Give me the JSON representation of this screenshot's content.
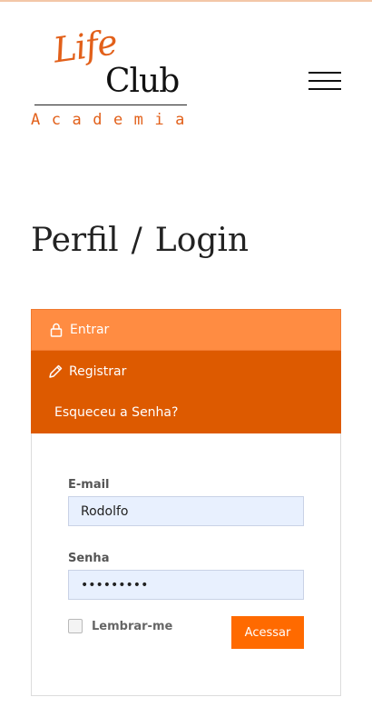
{
  "brand": {
    "logo_text_1": "Life",
    "logo_text_2": "Club",
    "logo_subtitle": "Academia",
    "accent_color": "#e2601a"
  },
  "header": {
    "menu_icon": "hamburger-menu-icon"
  },
  "page": {
    "title_part_1": "Perfil",
    "separator": "/",
    "title_part_2": "Login"
  },
  "tabs": {
    "entrar": {
      "label": "Entrar",
      "icon": "lock-icon",
      "color": "#ff8c42"
    },
    "registrar": {
      "label": "Registrar",
      "icon": "pencil-icon",
      "color": "#dd5a00"
    },
    "esqueceu": {
      "label": "Esqueceu a Senha?"
    }
  },
  "form": {
    "email_label": "E-mail",
    "email_value": "Rodolfo",
    "senha_label": "Senha",
    "senha_value": "•••••••••",
    "remember_label": "Lembrar-me",
    "remember_checked": false,
    "submit_label": "Acessar",
    "submit_color": "#ff6a00"
  }
}
